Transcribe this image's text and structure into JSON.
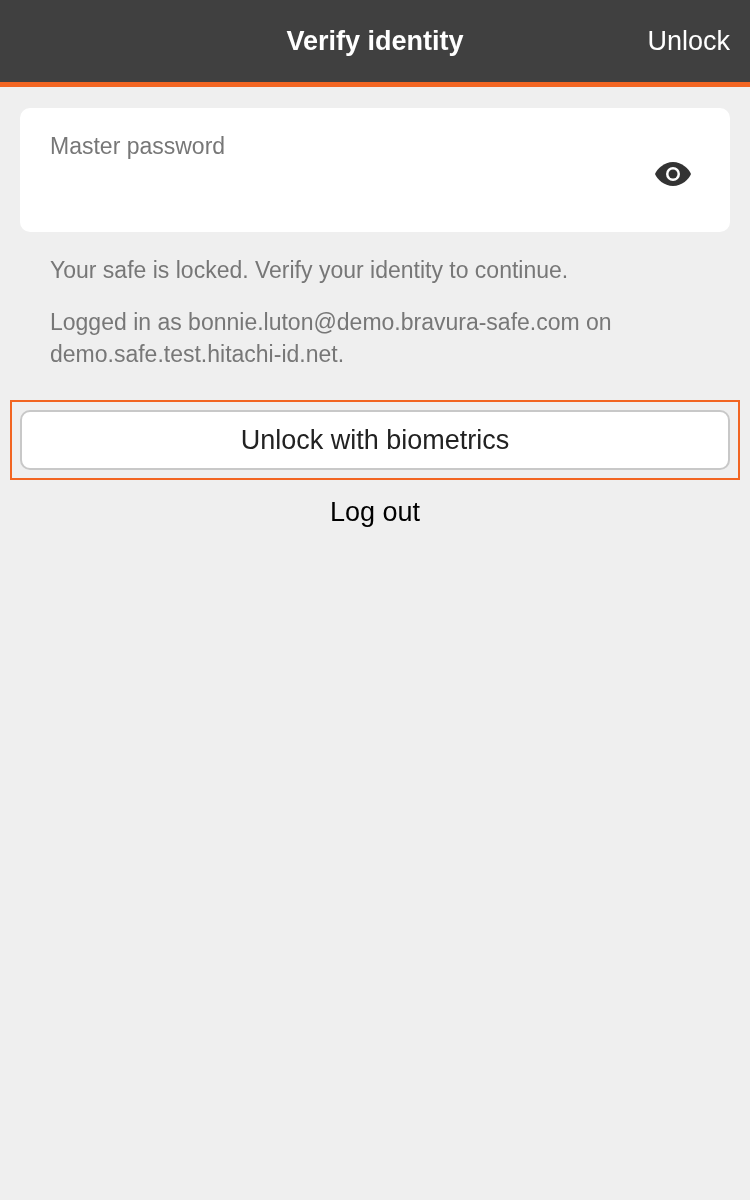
{
  "header": {
    "title": "Verify identity",
    "action": "Unlock"
  },
  "password_field": {
    "label": "Master password"
  },
  "messages": [
    "Your safe is locked. Verify your identity to continue.",
    "Logged in as bonnie.luton@demo.bravura-safe.com on demo.safe.test.hitachi-id.net."
  ],
  "biometrics_button": {
    "label": "Unlock with biometrics",
    "focused": true
  },
  "logout_link": "Log out"
}
